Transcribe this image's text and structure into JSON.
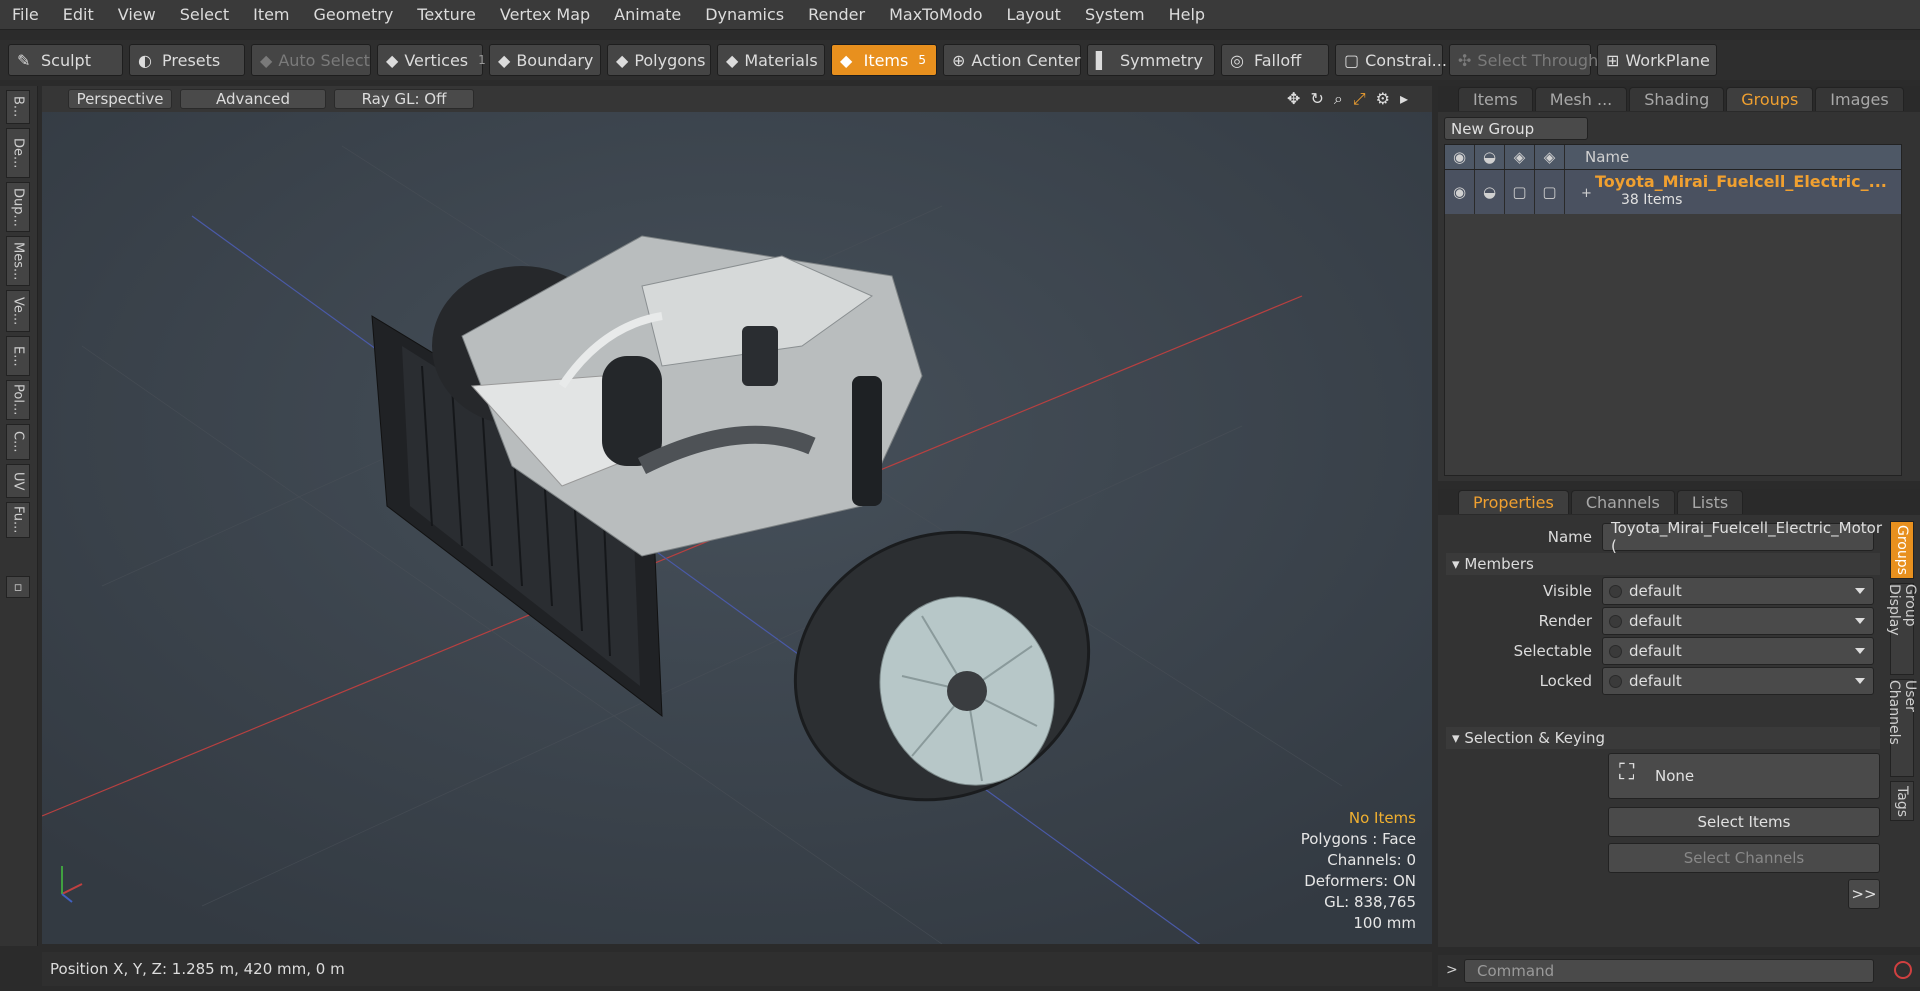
{
  "menu": [
    "File",
    "Edit",
    "View",
    "Select",
    "Item",
    "Geometry",
    "Texture",
    "Vertex Map",
    "Animate",
    "Dynamics",
    "Render",
    "MaxToModo",
    "Layout",
    "System",
    "Help"
  ],
  "toolbar": {
    "sculpt": "Sculpt",
    "presets": "Presets",
    "auto_select": "Auto Select",
    "vertices": "Vertices",
    "vertices_count": "1",
    "boundary": "Boundary",
    "polygons": "Polygons",
    "materials": "Materials",
    "items": "Items",
    "items_count": "5",
    "action_center": "Action Center",
    "symmetry": "Symmetry",
    "falloff": "Falloff",
    "constraints": "Constrai...",
    "select_through": "Select Through",
    "workplane": "WorkPlane"
  },
  "left_tabs": [
    "B...",
    "De...",
    "Dup...",
    "Mes...",
    "Ve...",
    "E...",
    "Pol...",
    "C...",
    "UV",
    "Fu..."
  ],
  "viewport": {
    "view": "Perspective",
    "mode": "Advanced",
    "raygl": "Ray GL: Off",
    "info": {
      "items": "No Items",
      "polygons": "Polygons : Face",
      "channels": "Channels: 0",
      "deformers": "Deformers: ON",
      "gl": "GL: 838,765",
      "scale": "100 mm"
    }
  },
  "status": {
    "position": "Position X, Y, Z:   1.285 m, 420 mm, 0 m"
  },
  "groups_panel": {
    "tabs": [
      "Items",
      "Mesh ...",
      "Shading",
      "Groups",
      "Images"
    ],
    "active_tab": "Groups",
    "new_group": "New Group",
    "name_col": "Name",
    "group_name": "Toyota_Mirai_Fuelcell_Electric_...",
    "group_count": "38 Items",
    "accent": "#f0a030"
  },
  "properties": {
    "tabs": [
      "Properties",
      "Channels",
      "Lists"
    ],
    "name_label": "Name",
    "name_value": "Toyota_Mirai_Fuelcell_Electric_Motor (",
    "members": "Members",
    "fields": [
      {
        "label": "Visible",
        "value": "default"
      },
      {
        "label": "Render",
        "value": "default"
      },
      {
        "label": "Selectable",
        "value": "default"
      },
      {
        "label": "Locked",
        "value": "default"
      }
    ],
    "selection_keying": "Selection & Keying",
    "none": "None",
    "select_items": "Select Items",
    "select_channels": "Select Channels",
    "more": ">>",
    "side_tabs": [
      "Groups",
      "Group Display",
      "User Channels",
      "Tags"
    ]
  },
  "command": {
    "placeholder": "Command"
  }
}
